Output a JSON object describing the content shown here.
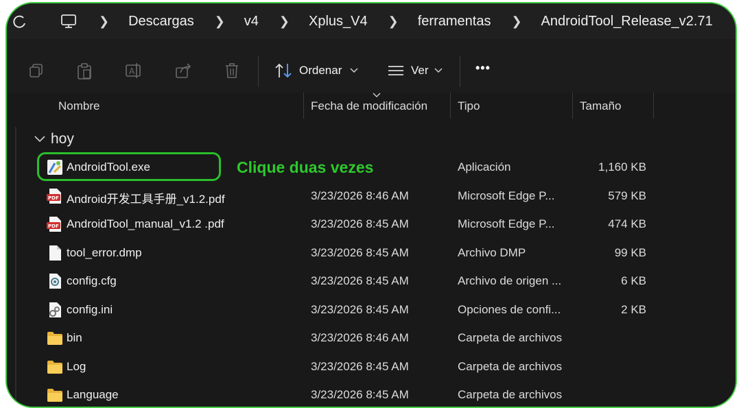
{
  "breadcrumb": [
    "Descargas",
    "v4",
    "Xplus_V4",
    "ferramentas",
    "AndroidTool_Release_v2.71"
  ],
  "toolbar": {
    "icons": [
      "copy-icon",
      "paste-icon",
      "rename-icon",
      "share-icon",
      "delete-icon"
    ],
    "sort_label": "Ordenar",
    "view_label": "Ver",
    "more_label": "•••"
  },
  "columns": {
    "name": "Nombre",
    "date": "Fecha de modificación",
    "type": "Tipo",
    "size": "Tamaño"
  },
  "group_label": "hoy",
  "annotation": "Clique duas vezes",
  "colors": {
    "annotation": "#2dc92d",
    "frame": "#3cc93c",
    "background": "#191919"
  },
  "files": [
    {
      "name": "AndroidTool.exe",
      "date": "",
      "type": "Aplicación",
      "size": "1,160 KB",
      "icon": "app-exe-icon"
    },
    {
      "name": "Android开发工具手册_v1.2.pdf",
      "date": "3/23/2026 8:46 AM",
      "type": "Microsoft Edge P...",
      "size": "579 KB",
      "icon": "pdf-icon"
    },
    {
      "name": "AndroidTool_manual_v1.2 .pdf",
      "date": "3/23/2026 8:45 AM",
      "type": "Microsoft Edge P...",
      "size": "474 KB",
      "icon": "pdf-icon"
    },
    {
      "name": "tool_error.dmp",
      "date": "3/23/2026 8:45 AM",
      "type": "Archivo DMP",
      "size": "99 KB",
      "icon": "blank-file-icon"
    },
    {
      "name": "config.cfg",
      "date": "3/23/2026 8:45 AM",
      "type": "Archivo de origen ...",
      "size": "6 KB",
      "icon": "config-file-icon"
    },
    {
      "name": "config.ini",
      "date": "3/23/2026 8:45 AM",
      "type": "Opciones de confi...",
      "size": "2 KB",
      "icon": "settings-file-icon"
    },
    {
      "name": "bin",
      "date": "3/23/2026 8:46 AM",
      "type": "Carpeta de archivos",
      "size": "",
      "icon": "folder-icon"
    },
    {
      "name": "Log",
      "date": "3/23/2026 8:45 AM",
      "type": "Carpeta de archivos",
      "size": "",
      "icon": "folder-icon"
    },
    {
      "name": "Language",
      "date": "3/23/2026 8:45 AM",
      "type": "Carpeta de archivos",
      "size": "",
      "icon": "folder-icon"
    }
  ]
}
